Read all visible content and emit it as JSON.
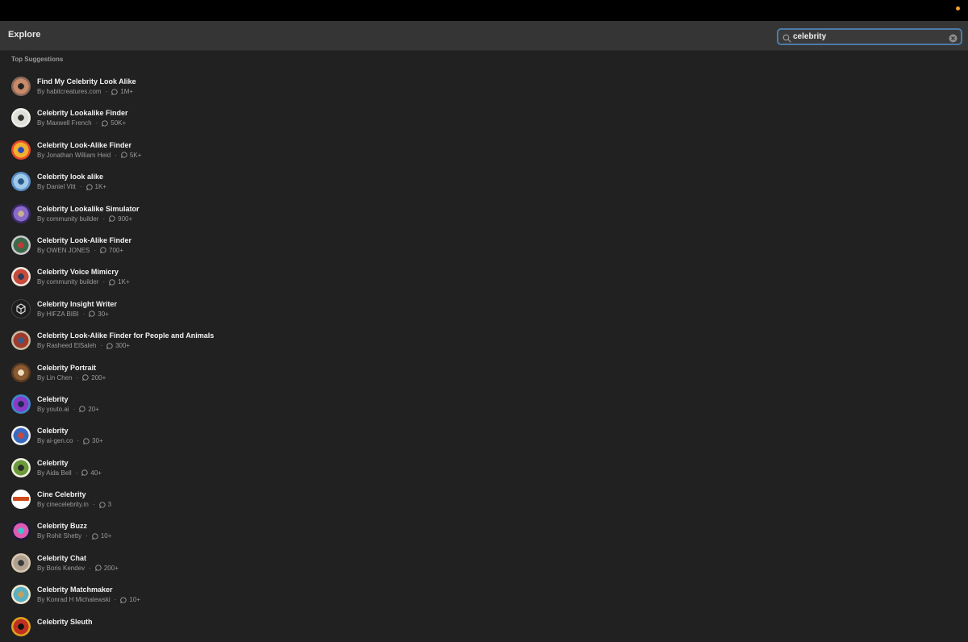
{
  "header": {
    "title": "Explore"
  },
  "search": {
    "value": "celebrity",
    "placeholder": "Search"
  },
  "section": {
    "label": "Top Suggestions"
  },
  "colors": {
    "accent_border": "#4d7aa8",
    "status_dot": "#f0a030"
  },
  "items": [
    {
      "title": "Find My Celebrity Look Alike",
      "author": "By habitcreatures.com",
      "conversations": "1M+",
      "avatar": [
        "#8a6a5a",
        "#c98a6a",
        "#222"
      ]
    },
    {
      "title": "Celebrity Lookalike Finder",
      "author": "By Maxwell French",
      "conversations": "50K+",
      "avatar": [
        "#f0f0ea",
        "#e0e0da",
        "#333"
      ]
    },
    {
      "title": "Celebrity Look-Alike Finder",
      "author": "By Jonathan William Heid",
      "conversations": "5K+",
      "avatar": [
        "#e84a2a",
        "#f0b030",
        "#2a4ac0"
      ]
    },
    {
      "title": "Celebrity look alike",
      "author": "By Daniel Vitt",
      "conversations": "1K+",
      "avatar": [
        "#5a90c8",
        "#a0c8e8",
        "#2a5a8a"
      ]
    },
    {
      "title": "Celebrity Lookalike Simulator",
      "author": "By community builder",
      "conversations": "900+",
      "avatar": [
        "#3a2a6a",
        "#8a6ac8",
        "#c8b090"
      ]
    },
    {
      "title": "Celebrity Look-Alike Finder",
      "author": "By OWEN JONES",
      "conversations": "700+",
      "avatar": [
        "#c8c8c8",
        "#3a6a4a",
        "#c03a3a"
      ]
    },
    {
      "title": "Celebrity Voice Mimicry",
      "author": "By community builder",
      "conversations": "1K+",
      "avatar": [
        "#f0e8e0",
        "#c84a3a",
        "#2a3a5a"
      ]
    },
    {
      "title": "Celebrity Insight Writer",
      "author": "By HIFZA BIBI",
      "conversations": "30+",
      "avatar": [
        "#1e1e1e",
        "#1e1e1e",
        "#e0e0e0"
      ]
    },
    {
      "title": "Celebrity Look-Alike Finder for People and Animals",
      "author": "By Rasheed ElSaleh",
      "conversations": "300+",
      "avatar": [
        "#c8b8a0",
        "#a03a2a",
        "#3a5a8a"
      ]
    },
    {
      "title": "Celebrity Portrait",
      "author": "By Lin Chen",
      "conversations": "200+",
      "avatar": [
        "#5a3a20",
        "#8a5a30",
        "#f0e0c0"
      ]
    },
    {
      "title": "Celebrity",
      "author": "By youto.ai",
      "conversations": "20+",
      "avatar": [
        "#3a8ac8",
        "#8a3ac8",
        "#1a2a4a"
      ]
    },
    {
      "title": "Celebrity",
      "author": "By ai-gen.co",
      "conversations": "30+",
      "avatar": [
        "#f0f0f0",
        "#3a6ac0",
        "#c84a3a"
      ]
    },
    {
      "title": "Celebrity",
      "author": "By Aida Bell",
      "conversations": "40+",
      "avatar": [
        "#f0f0e0",
        "#6a9a3a",
        "#2a2a2a"
      ]
    },
    {
      "title": "Cine Celebrity",
      "author": "By cinecelebrity.in",
      "conversations": "3",
      "avatar": [
        "#ffffff",
        "#ffffff",
        "#d04a1a"
      ]
    },
    {
      "title": "Celebrity Buzz",
      "author": "By Rohit Shetty",
      "conversations": "10+",
      "avatar": [
        "#1a1a3a",
        "#e05ab0",
        "#40c0d0"
      ]
    },
    {
      "title": "Celebrity Chat",
      "author": "By Boris Kendev",
      "conversations": "200+",
      "avatar": [
        "#d8c8b0",
        "#b0a090",
        "#3a3a3a"
      ]
    },
    {
      "title": "Celebrity Matchmaker",
      "author": "By Konrad H Michalewski",
      "conversations": "10+",
      "avatar": [
        "#f0e8d0",
        "#5ab0c0",
        "#c0a060"
      ]
    },
    {
      "title": "Celebrity Sleuth",
      "author": "",
      "conversations": "",
      "avatar": [
        "#e0a020",
        "#c03020",
        "#111"
      ]
    }
  ]
}
